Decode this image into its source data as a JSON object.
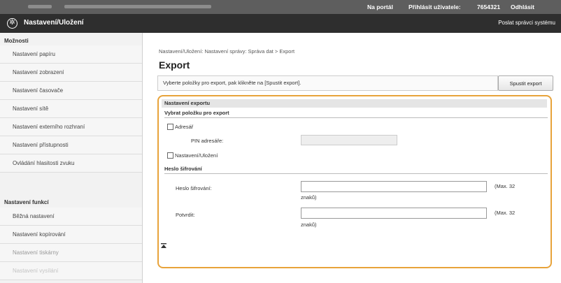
{
  "topbar": {
    "portal": "Na portál",
    "login_label": "Přihlásit uživatele:",
    "user_id": "7654321",
    "logout": "Odhlásit"
  },
  "header": {
    "title": "Nastavení/Uložení",
    "send_link": "Poslat správci systému"
  },
  "sidebar": {
    "sections": [
      {
        "heading": "Možnosti"
      },
      {
        "heading": "Nastavení funkcí"
      }
    ],
    "items": [
      {
        "label": "Nastavení papíru"
      },
      {
        "label": "Nastavení zobrazení"
      },
      {
        "label": "Nastavení časovače"
      },
      {
        "label": "Nastavení sítě"
      },
      {
        "label": "Nastavení externího rozhraní"
      },
      {
        "label": "Nastavení přístupnosti"
      },
      {
        "label": "Ovládání hlasitosti zvuku"
      },
      {
        "label": "Běžná nastavení"
      },
      {
        "label": "Nastavení kopírování"
      },
      {
        "label": "Nastavení tiskárny"
      },
      {
        "label": "Nastavení vysílání"
      }
    ]
  },
  "main": {
    "breadcrumb": "Nastavení/Uložení: Nastavení správy: Správa dat > Export",
    "title": "Export",
    "instruction": "Vyberte položky pro export, pak klikněte na [Spustit export].",
    "start_button": "Spustit export",
    "settings": {
      "header": "Nastavení exportu",
      "select_section": "Vybrat položku pro export",
      "address_book": "Adresář",
      "pin_label": "PIN adresáře:",
      "settings_item": "Nastavení/Uložení",
      "password_section": "Heslo šifrování",
      "password_label": "Heslo šifrování:",
      "password_hint": "(Max. 32",
      "password_hint2": "znaků)",
      "confirm_label": "Potvrdit:",
      "confirm_hint": "(Max. 32",
      "confirm_hint2": "znaků)"
    }
  },
  "colors": {
    "highlight": "#e8a33a",
    "title_bar": "#2e2e2e",
    "top_bar": "#5e5e5e"
  },
  "icons": {
    "header_icon": "settings-gear-icon",
    "back_to_top": "back-to-top-icon"
  }
}
